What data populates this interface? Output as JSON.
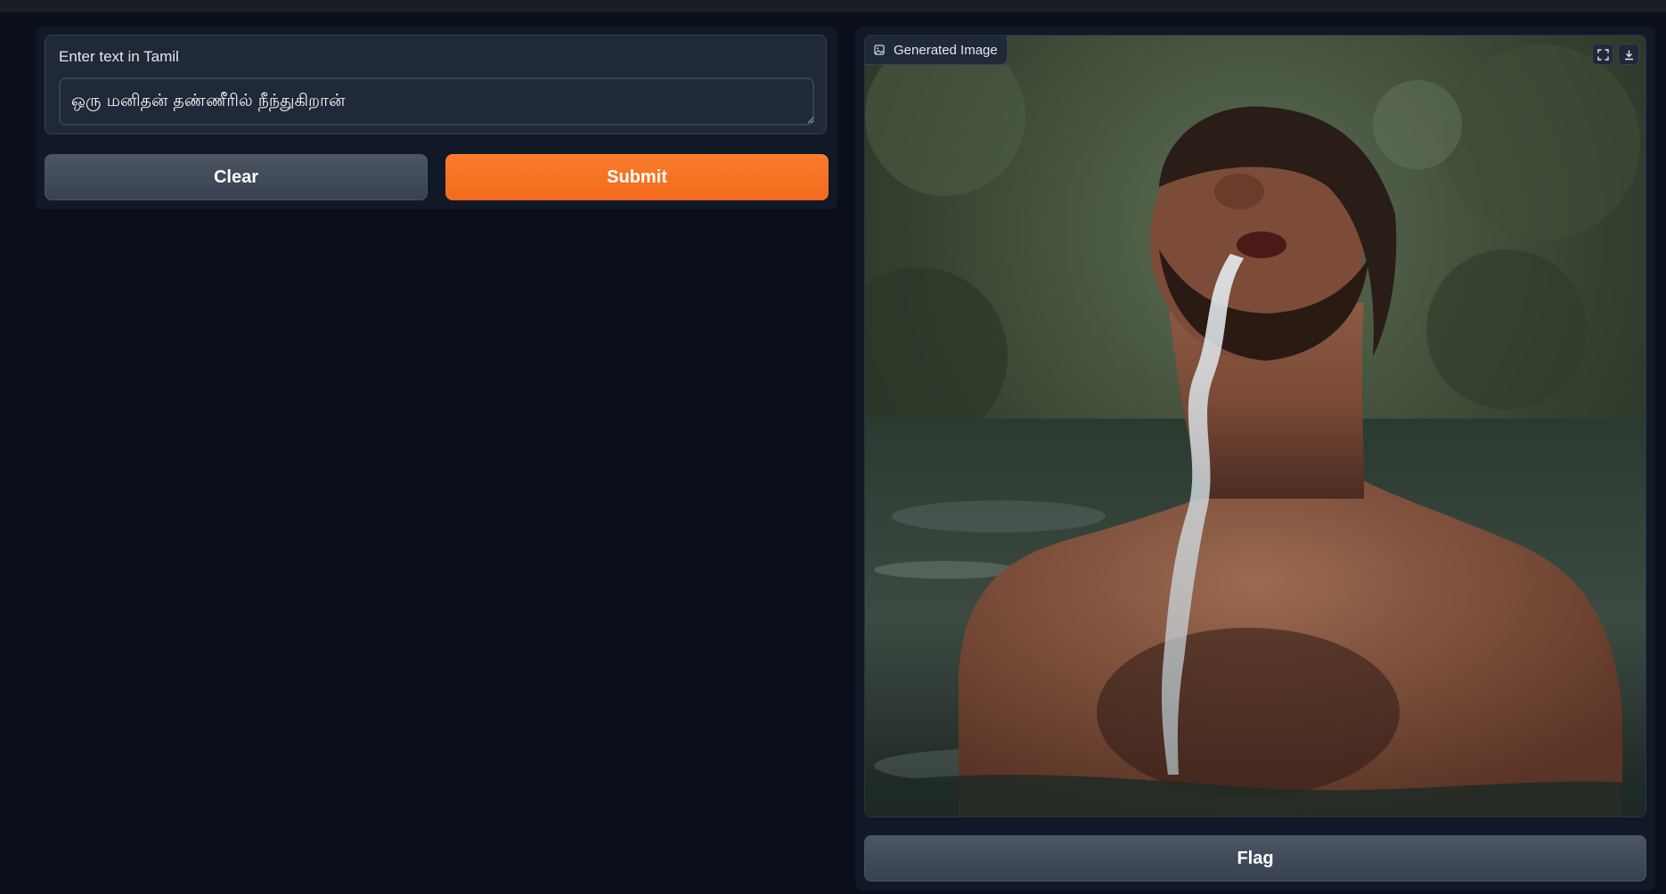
{
  "input": {
    "label": "Enter text in Tamil",
    "value": "ஒரு மனிதன் தண்ணீரில் நீந்துகிறான்"
  },
  "buttons": {
    "clear_label": "Clear",
    "submit_label": "Submit",
    "flag_label": "Flag"
  },
  "output": {
    "label": "Generated Image",
    "icons": [
      "image-icon",
      "fullscreen-icon",
      "download-icon"
    ]
  },
  "colors": {
    "background": "#0b0f19",
    "panel": "#111827",
    "accent": "#f97316",
    "secondary_button": "#4b5563"
  }
}
